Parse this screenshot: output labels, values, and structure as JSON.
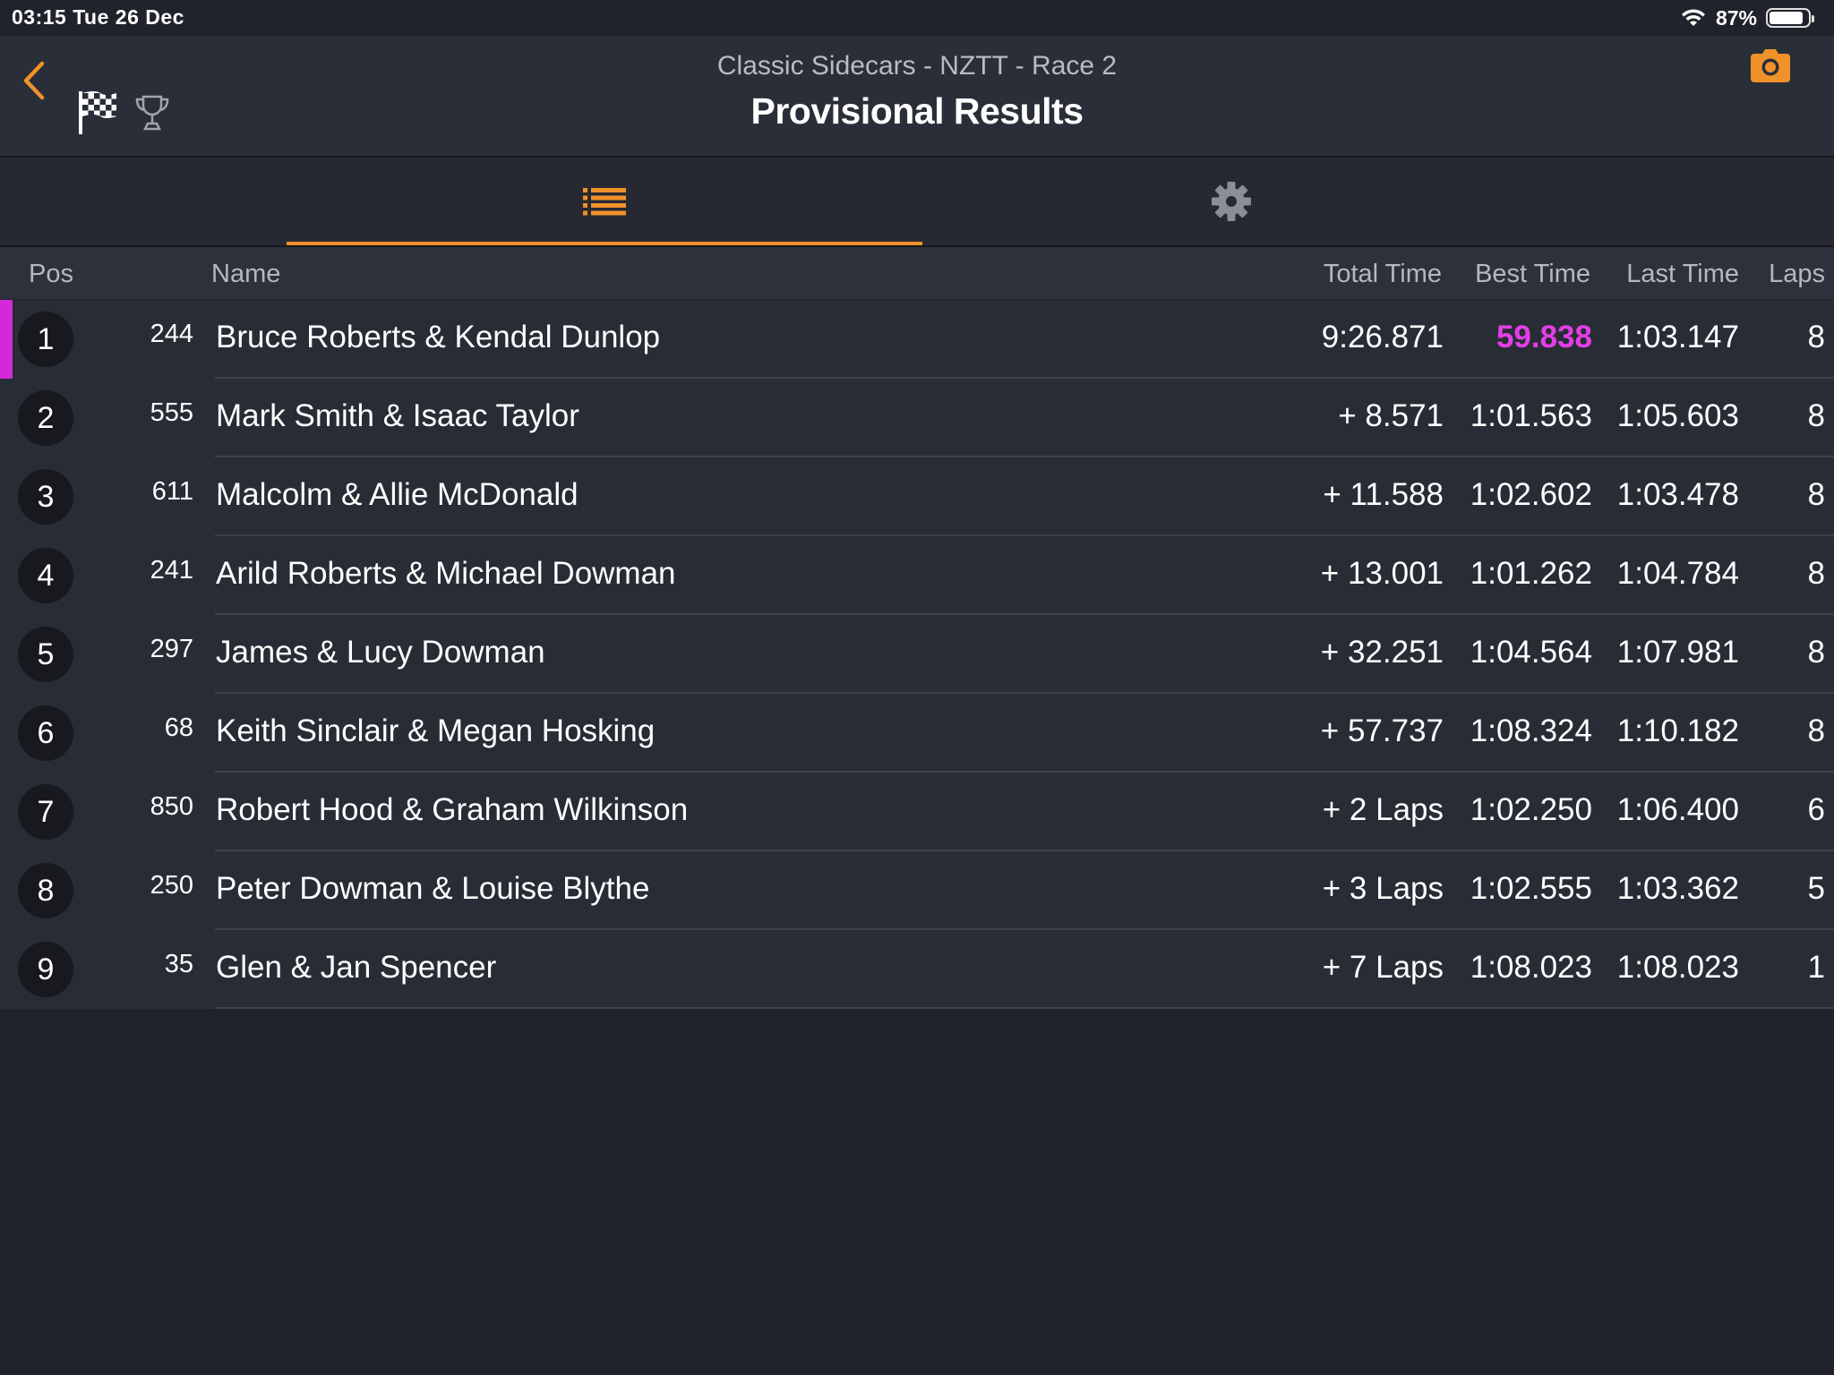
{
  "status": {
    "time_date": "03:15  Tue 26 Dec",
    "battery": "87%",
    "battery_level": 0.87
  },
  "header": {
    "subtitle": "Classic Sidecars - NZTT - Race 2",
    "title": "Provisional Results"
  },
  "columns": {
    "pos": "Pos",
    "name": "Name",
    "total": "Total Time",
    "best": "Best Time",
    "last": "Last Time",
    "laps": "Laps"
  },
  "rows": [
    {
      "pos": "1",
      "num": "244",
      "name": "Bruce Roberts & Kendal Dunlop",
      "total": "9:26.871",
      "best": "59.838",
      "last": "1:03.147",
      "laps": "8"
    },
    {
      "pos": "2",
      "num": "555",
      "name": "Mark Smith & Isaac Taylor",
      "total": "+ 8.571",
      "best": "1:01.563",
      "last": "1:05.603",
      "laps": "8"
    },
    {
      "pos": "3",
      "num": "611",
      "name": "Malcolm & Allie McDonald",
      "total": "+ 11.588",
      "best": "1:02.602",
      "last": "1:03.478",
      "laps": "8"
    },
    {
      "pos": "4",
      "num": "241",
      "name": "Arild Roberts & Michael Dowman",
      "total": "+ 13.001",
      "best": "1:01.262",
      "last": "1:04.784",
      "laps": "8"
    },
    {
      "pos": "5",
      "num": "297",
      "name": "James & Lucy Dowman",
      "total": "+ 32.251",
      "best": "1:04.564",
      "last": "1:07.981",
      "laps": "8"
    },
    {
      "pos": "6",
      "num": "68",
      "name": "Keith Sinclair & Megan Hosking",
      "total": "+ 57.737",
      "best": "1:08.324",
      "last": "1:10.182",
      "laps": "8"
    },
    {
      "pos": "7",
      "num": "850",
      "name": "Robert Hood & Graham Wilkinson",
      "total": "+ 2 Laps",
      "best": "1:02.250",
      "last": "1:06.400",
      "laps": "6"
    },
    {
      "pos": "8",
      "num": "250",
      "name": "Peter Dowman & Louise Blythe",
      "total": "+ 3 Laps",
      "best": "1:02.555",
      "last": "1:03.362",
      "laps": "5"
    },
    {
      "pos": "9",
      "num": "35",
      "name": "Glen & Jan Spencer",
      "total": "+ 7 Laps",
      "best": "1:08.023",
      "last": "1:08.023",
      "laps": "1"
    }
  ],
  "colors": {
    "accent": "#f0922a",
    "fastest_lap": "#e23fe6",
    "background": "#20232b"
  },
  "icons": {
    "back": "chevron-left-icon",
    "flag": "checkered-flag-icon",
    "trophy": "trophy-icon",
    "camera": "camera-icon",
    "list": "list-icon",
    "settings": "gear-icon"
  }
}
